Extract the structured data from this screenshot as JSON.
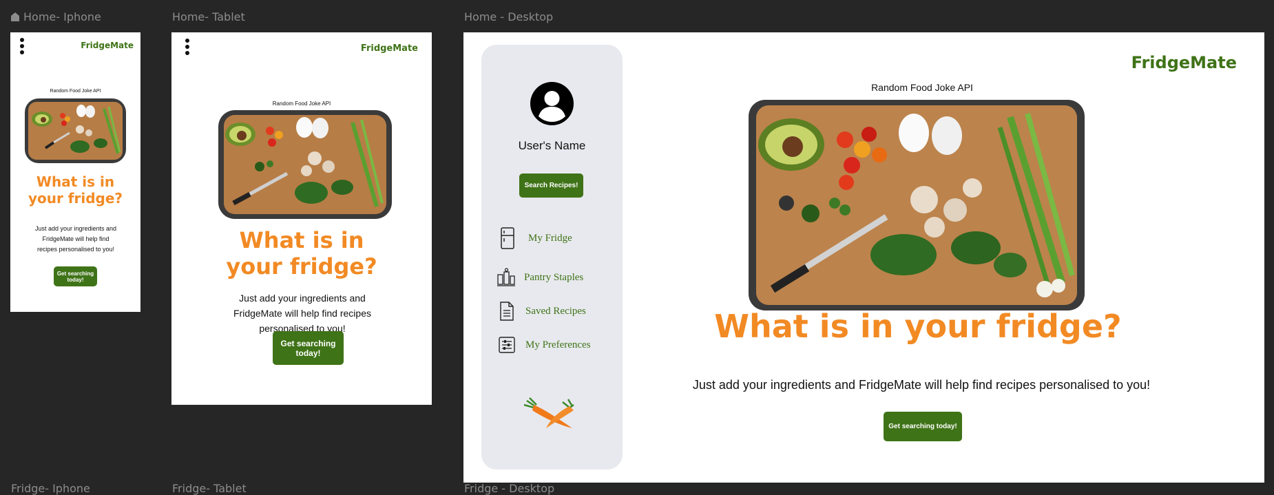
{
  "canvas": {
    "frame_labels": {
      "iphone": "Home- Iphone",
      "tablet": "Home- Tablet",
      "desktop": "Home - Desktop",
      "fridge_iphone": "Fridge- Iphone",
      "fridge_tablet": "Fridge- Tablet",
      "fridge_desktop": "Fridge - Desktop"
    },
    "home_icon": "home-icon"
  },
  "app": {
    "brand": "FridgeMate",
    "api_label": "Random Food Joke API",
    "headline": "What is in your fridge?",
    "headline_line1": "What is in",
    "headline_line2": "your fridge?",
    "description": "Just add your ingredients and FridgeMate will help find recipes personalised to you!",
    "cta": "Get searching today!",
    "colors": {
      "brand": "#3f7317",
      "headline": "#f28a24",
      "sidebar": "#e8e9ee",
      "canvas": "#262626"
    }
  },
  "sidebar": {
    "user_name": "User's Name",
    "search_button": "Search Recipes!",
    "items": [
      {
        "label": "My Fridge",
        "icon": "fridge-icon"
      },
      {
        "label": "Pantry Staples",
        "icon": "pantry-jars-icon"
      },
      {
        "label": "Saved Recipes",
        "icon": "document-icon"
      },
      {
        "label": "My Preferences",
        "icon": "preferences-sliders-icon"
      }
    ],
    "illustration": "carrots-illustration"
  }
}
